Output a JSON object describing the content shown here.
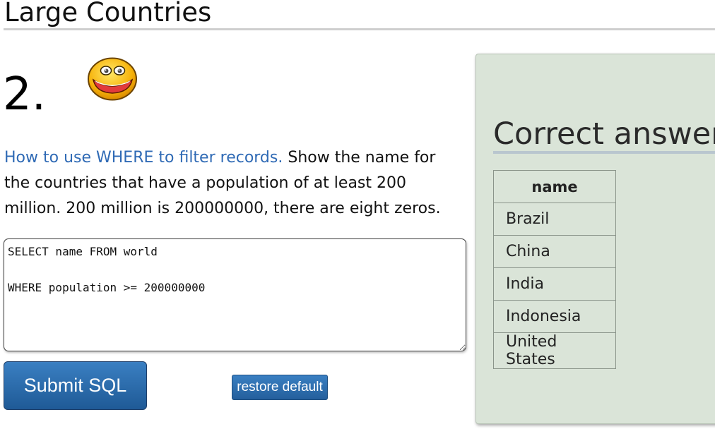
{
  "page": {
    "title": "Large Countries"
  },
  "question": {
    "number": "2.",
    "link_text": "How to use WHERE to filter records.",
    "text": " Show the name for the countries that have a population of at least 200 million. 200 million is 200000000, there are eight zeros."
  },
  "editor": {
    "sql": "SELECT name FROM world\n\nWHERE population >= 200000000"
  },
  "buttons": {
    "submit_label": "Submit SQL",
    "restore_label": "restore default"
  },
  "answer": {
    "heading": "Correct answer",
    "column_header": "name",
    "rows": [
      "Brazil",
      "China",
      "India",
      "Indonesia",
      "United States"
    ]
  },
  "colors": {
    "link": "#2f6ab5",
    "button": "#2a6aac",
    "panel_bg": "#dae4d8"
  }
}
